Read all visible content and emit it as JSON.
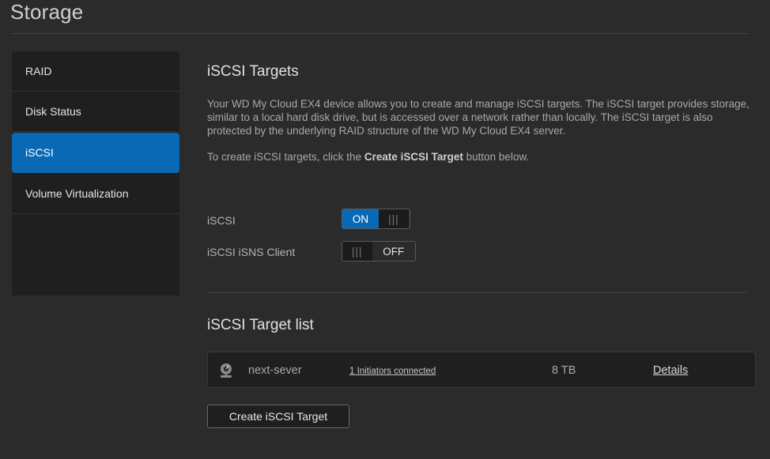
{
  "page": {
    "title": "Storage"
  },
  "sidebar": {
    "items": [
      {
        "label": "RAID"
      },
      {
        "label": "Disk Status"
      },
      {
        "label": "iSCSI"
      },
      {
        "label": "Volume Virtualization"
      }
    ],
    "active_index": 2
  },
  "main": {
    "heading": "iSCSI Targets",
    "description": "Your WD My Cloud EX4 device allows you to create and manage iSCSI targets. The iSCSI target provides storage, similar to a local hard disk drive, but is accessed over a network rather than locally. The iSCSI target is also protected by the underlying RAID structure of the WD My Cloud EX4 server.",
    "create_hint_prefix": "To create iSCSI targets, click the ",
    "create_hint_bold": "Create iSCSI Target",
    "create_hint_suffix": " button below.",
    "settings": {
      "iscsi": {
        "label": "iSCSI",
        "state_label": "ON",
        "grip": "|||"
      },
      "isns": {
        "label": "iSCSI iSNS Client",
        "state_label": "OFF",
        "grip": "|||"
      }
    },
    "list_heading": "iSCSI Target list",
    "targets": [
      {
        "icon": "server-target-icon",
        "name": "next-sever",
        "initiators": "1 Initiators connected",
        "size": "8 TB",
        "details": "Details"
      }
    ],
    "create_button": "Create iSCSI Target"
  },
  "colors": {
    "background": "#2b2b2b",
    "panel": "#1f1f1f",
    "accent": "#0a69b4"
  }
}
